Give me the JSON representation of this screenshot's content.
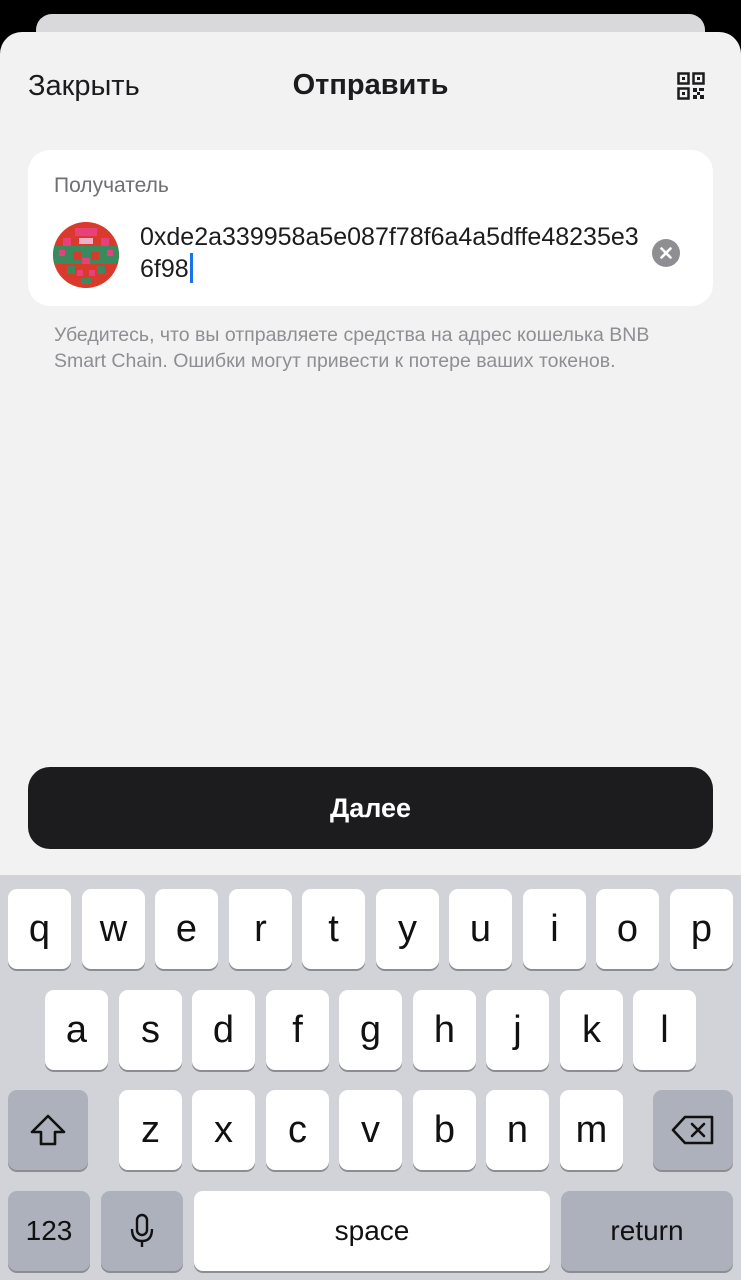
{
  "header": {
    "close_label": "Закрыть",
    "title": "Отправить",
    "qr_icon": "qr-code-icon"
  },
  "recipient": {
    "label": "Получатель",
    "address": "0xde2a339958a5e087f78f6a4a5dffe48235e36f98",
    "avatar_icon": "identicon-avatar",
    "clear_icon": "clear-icon"
  },
  "warning_text": "Убедитесь, что вы отправляете средства на адрес кошелька BNB Smart Chain. Ошибки могут привести к потере ваших токенов.",
  "next_button_label": "Далее",
  "keyboard": {
    "row1": [
      "q",
      "w",
      "e",
      "r",
      "t",
      "y",
      "u",
      "i",
      "o",
      "p"
    ],
    "row2": [
      "a",
      "s",
      "d",
      "f",
      "g",
      "h",
      "j",
      "k",
      "l"
    ],
    "row3": [
      "z",
      "x",
      "c",
      "v",
      "b",
      "n",
      "m"
    ],
    "numbers_label": "123",
    "space_label": "space",
    "return_label": "return",
    "shift_icon": "shift-icon",
    "delete_icon": "backspace-icon",
    "mic_icon": "microphone-icon"
  },
  "colors": {
    "accent_caret": "#1a73e8",
    "button_dark": "#1c1c1e",
    "sheet_bg": "#f2f2f3"
  }
}
